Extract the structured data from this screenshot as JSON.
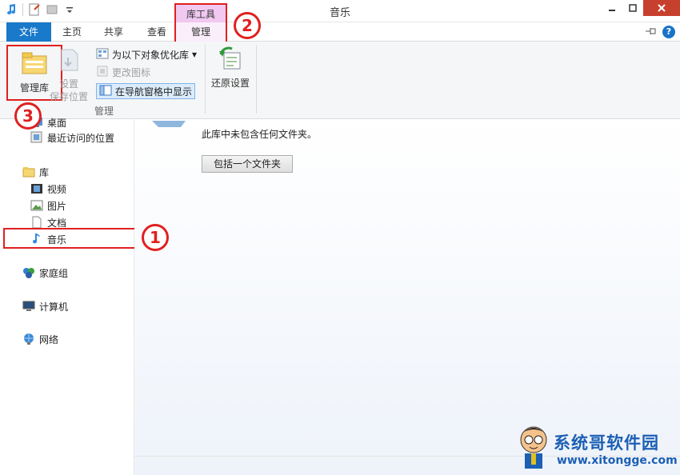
{
  "window": {
    "title": "音乐"
  },
  "context_tab": {
    "group_label": "库工具",
    "tab_label": "管理"
  },
  "tabs": [
    "文件",
    "主页",
    "共享",
    "查看"
  ],
  "ribbon": {
    "manage_library": "管理库",
    "set_save_location": "设置\n保存位置",
    "optimize_for": "为以下对象优化库",
    "change_icon": "更改图标",
    "show_in_nav": "在导航窗格中显示",
    "restore_settings": "还原设置",
    "group_label": "管理"
  },
  "nav": {
    "items": [
      {
        "label": "桌面",
        "icon": "desktop-icon"
      },
      {
        "label": "最近访问的位置",
        "icon": "recent-places-icon"
      },
      {
        "label": "库",
        "icon": "library-icon"
      },
      {
        "label": "视频",
        "icon": "video-library-icon"
      },
      {
        "label": "图片",
        "icon": "pictures-library-icon"
      },
      {
        "label": "文档",
        "icon": "documents-library-icon"
      },
      {
        "label": "音乐",
        "icon": "music-library-icon"
      },
      {
        "label": "家庭组",
        "icon": "homegroup-icon"
      },
      {
        "label": "计算机",
        "icon": "computer-icon"
      },
      {
        "label": "网络",
        "icon": "network-icon"
      }
    ]
  },
  "content": {
    "empty_message": "此库中未包含任何文件夹。",
    "include_button": "包括一个文件夹"
  },
  "annotations": {
    "m1": "1",
    "m2": "2",
    "m3": "3"
  },
  "watermark": {
    "name": "系统哥软件园",
    "url": "www.xitongge.com"
  },
  "colors": {
    "accent": "#1979ca",
    "annotation": "#e02020",
    "context": "#f0c8f0"
  }
}
